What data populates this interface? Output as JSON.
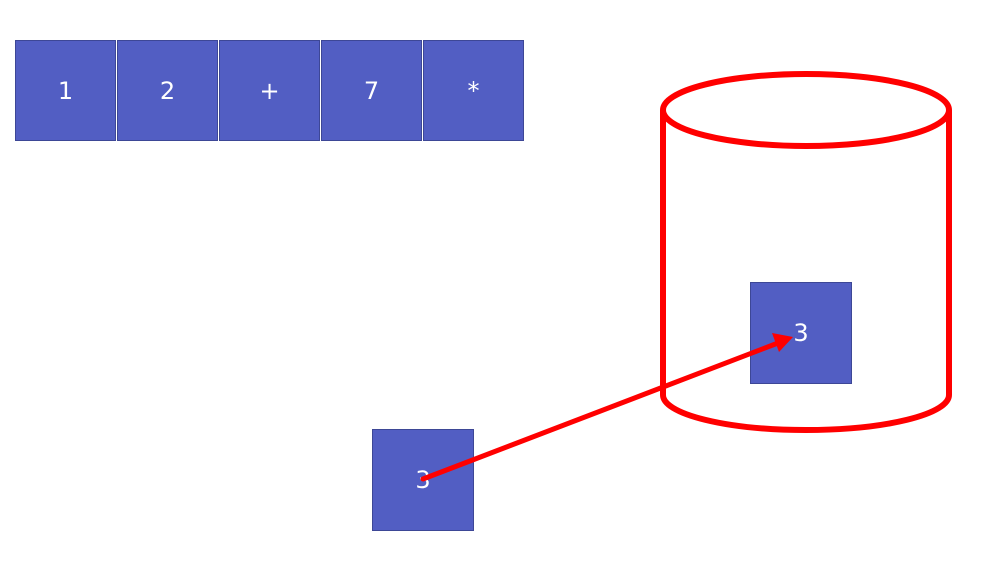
{
  "input_tokens": [
    "1",
    "2",
    "+",
    "7",
    "*"
  ],
  "stack": {
    "items": [
      "3"
    ],
    "outline_color": "#ff0000"
  },
  "moving_value": "3",
  "arrow": {
    "color": "#ff0000",
    "direction": "push-to-stack"
  },
  "colors": {
    "token_fill": "#525ec3",
    "token_text": "#ffffff",
    "accent": "#ff0000"
  }
}
